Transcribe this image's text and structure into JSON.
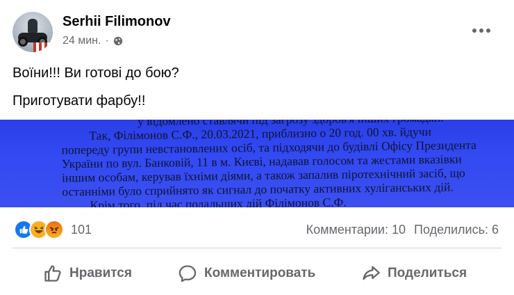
{
  "post": {
    "author": "Serhii Filimonov",
    "time": "24 мин.",
    "separator": "·",
    "text_line_1": "Воїни!!! Ви готові до бою?",
    "text_line_2": "Приготувати фарбу!!",
    "photo_text": [
      "у відомлено ставлячи під загрозу здоров'я інших громадян.",
      "Так, Філімонов С.Ф., 20.03.2021, приблизно о 20 год. 00 хв. йдучи",
      "попереду групи невстановлених осіб, та підходячи до будівлі Офісу Президента",
      "України по вул. Банковій, 11 в м. Києві, надавав голосом та жестами вказівки",
      "іншим особам, керував їхніми діями, а також запалив піротехнічний засіб, що",
      "останніми було сприйнято як сигнал до початку активних хуліганських дій.",
      "Крім того, під час подальших дій Філімонов С.Ф."
    ]
  },
  "reactions": {
    "count": "101",
    "types": [
      "like",
      "haha",
      "angry"
    ]
  },
  "stats": {
    "comments": "Комментарии: 10",
    "shares": "Поделились: 6"
  },
  "actions": {
    "like": "Нравится",
    "comment": "Комментировать",
    "share": "Поделиться"
  },
  "icons": {
    "privacy": "globe-icon",
    "more": "more-options-icon",
    "like": "thumbs-up-icon",
    "comment": "comment-bubble-icon",
    "share": "share-arrow-icon"
  },
  "colors": {
    "secondary_text": "#65676b",
    "like_blue": "#1877f2",
    "photo_blue": "#3349f2"
  }
}
